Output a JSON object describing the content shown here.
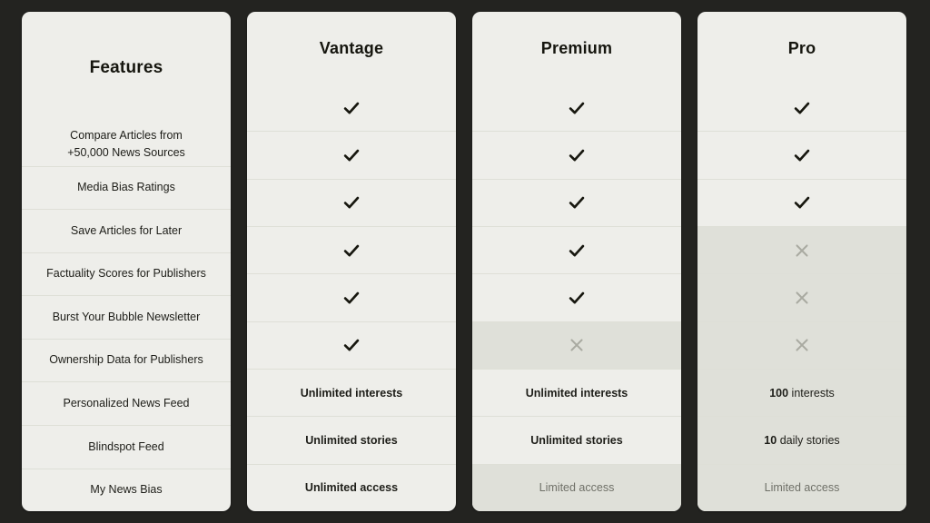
{
  "table": {
    "features_header": "Features",
    "features": [
      "Compare Articles from\n+50,000 News Sources",
      "Media Bias Ratings",
      "Save Articles for Later",
      "Factuality Scores for Publishers",
      "Burst Your Bubble Newsletter",
      "Ownership Data for Publishers",
      "Personalized News Feed",
      "Blindspot Feed",
      "My News Bias"
    ],
    "plans": [
      {
        "name": "Vantage",
        "cells": [
          {
            "type": "check",
            "icon": "check-icon",
            "shaded": false
          },
          {
            "type": "check",
            "icon": "check-icon",
            "shaded": false
          },
          {
            "type": "check",
            "icon": "check-icon",
            "shaded": false
          },
          {
            "type": "check",
            "icon": "check-icon",
            "shaded": false
          },
          {
            "type": "check",
            "icon": "check-icon",
            "shaded": false
          },
          {
            "type": "check",
            "icon": "check-icon",
            "shaded": false
          },
          {
            "type": "text",
            "text": "Unlimited interests",
            "muted": false,
            "shaded": false
          },
          {
            "type": "text",
            "text": "Unlimited stories",
            "muted": false,
            "shaded": false
          },
          {
            "type": "text",
            "text": "Unlimited access",
            "muted": false,
            "shaded": false
          }
        ]
      },
      {
        "name": "Premium",
        "cells": [
          {
            "type": "check",
            "icon": "check-icon",
            "shaded": false
          },
          {
            "type": "check",
            "icon": "check-icon",
            "shaded": false
          },
          {
            "type": "check",
            "icon": "check-icon",
            "shaded": false
          },
          {
            "type": "check",
            "icon": "check-icon",
            "shaded": false
          },
          {
            "type": "check",
            "icon": "check-icon",
            "shaded": false
          },
          {
            "type": "cross",
            "icon": "cross-icon",
            "shaded": true
          },
          {
            "type": "text",
            "text": "Unlimited interests",
            "muted": false,
            "shaded": false
          },
          {
            "type": "text",
            "text": "Unlimited stories",
            "muted": false,
            "shaded": false
          },
          {
            "type": "text",
            "text": "Limited access",
            "muted": true,
            "shaded": true
          }
        ]
      },
      {
        "name": "Pro",
        "cells": [
          {
            "type": "check",
            "icon": "check-icon",
            "shaded": false
          },
          {
            "type": "check",
            "icon": "check-icon",
            "shaded": false
          },
          {
            "type": "check",
            "icon": "check-icon",
            "shaded": false
          },
          {
            "type": "cross",
            "icon": "cross-icon",
            "shaded": true
          },
          {
            "type": "cross",
            "icon": "cross-icon",
            "shaded": true
          },
          {
            "type": "cross",
            "icon": "cross-icon",
            "shaded": true
          },
          {
            "type": "rich",
            "num": "100",
            "unit": "interests",
            "shaded": true
          },
          {
            "type": "rich",
            "num": "10",
            "unit": "daily stories",
            "shaded": true
          },
          {
            "type": "text",
            "text": "Limited access",
            "muted": true,
            "shaded": true
          }
        ]
      }
    ]
  },
  "colors": {
    "page_background": "#232320",
    "card_background": "#eeeeea",
    "shaded_cell": "#dfe0d9",
    "divider": "#dedfd7",
    "text": "#1d1d18",
    "muted_text": "#6f7068",
    "check": "#17170f",
    "cross": "#a9aaa1"
  }
}
